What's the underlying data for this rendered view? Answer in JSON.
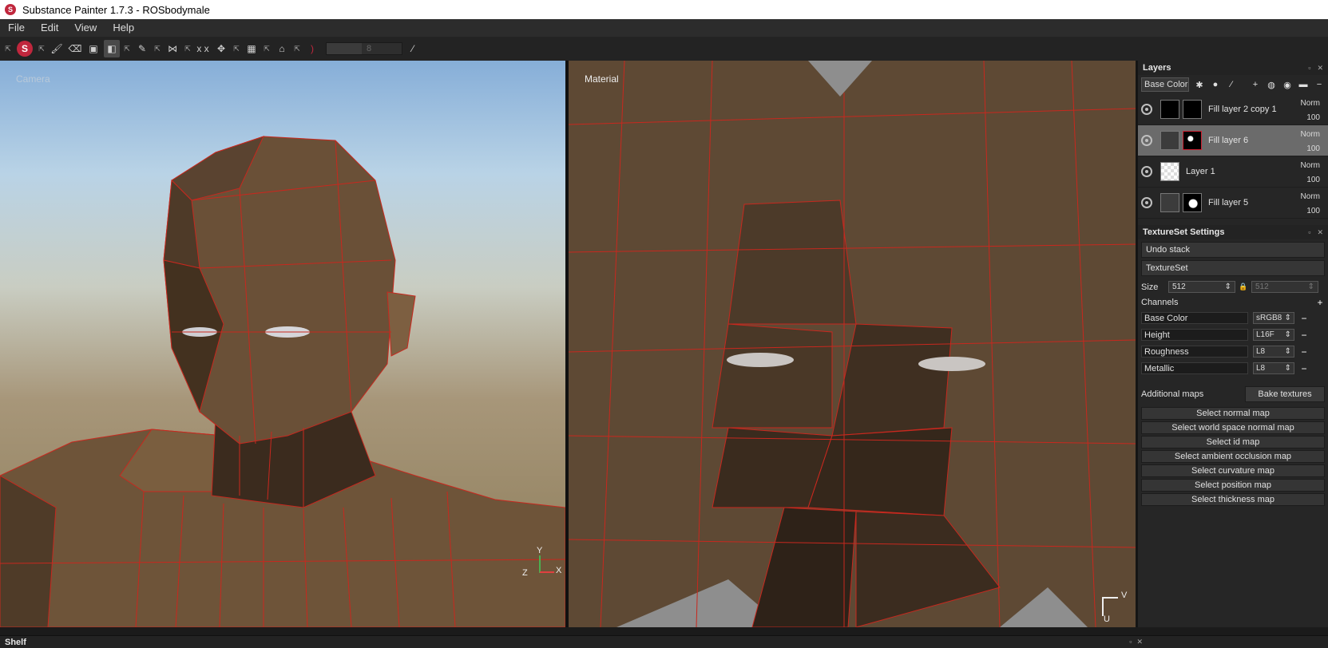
{
  "titlebar": {
    "title": "Substance Painter 1.7.3 - ROSbodymale",
    "icon": "substance-logo"
  },
  "menu": {
    "items": [
      "File",
      "Edit",
      "View",
      "Help"
    ]
  },
  "toolbar": {
    "brush_size": "8",
    "logo": "S"
  },
  "viewports": {
    "left_label": "Camera",
    "right_label": "Material",
    "axis_x": "X",
    "axis_y": "Y",
    "axis_z": "Z",
    "uv_u": "U",
    "uv_v": "V"
  },
  "layers": {
    "title": "Layers",
    "channel": "Base Color",
    "items": [
      {
        "name": "Fill layer 2 copy 1",
        "blend": "Norm",
        "opacity": "100",
        "selected": false
      },
      {
        "name": "Fill layer 6",
        "blend": "Norm",
        "opacity": "100",
        "selected": true
      },
      {
        "name": "Layer 1",
        "blend": "Norm",
        "opacity": "100",
        "selected": false
      },
      {
        "name": "Fill layer 5",
        "blend": "Norm",
        "opacity": "100",
        "selected": false
      }
    ]
  },
  "textureset": {
    "title": "TextureSet Settings",
    "undo_stack": "Undo stack",
    "textureset_label": "TextureSet",
    "size_label": "Size",
    "size_value": "512",
    "size_value2": "512",
    "channels_label": "Channels",
    "channels": [
      {
        "name": "Base Color",
        "format": "sRGB8"
      },
      {
        "name": "Height",
        "format": "L16F"
      },
      {
        "name": "Roughness",
        "format": "L8"
      },
      {
        "name": "Metallic",
        "format": "L8"
      }
    ],
    "additional_maps": "Additional maps",
    "bake_textures": "Bake textures",
    "maps": [
      "Select normal map",
      "Select world space normal map",
      "Select id map",
      "Select ambient occlusion map",
      "Select curvature map",
      "Select position map",
      "Select thickness map"
    ]
  },
  "shelf": {
    "title": "Shelf"
  },
  "colors": {
    "brand": "#c0273d",
    "wire": "#c8281e",
    "skin": "#6b5238"
  }
}
